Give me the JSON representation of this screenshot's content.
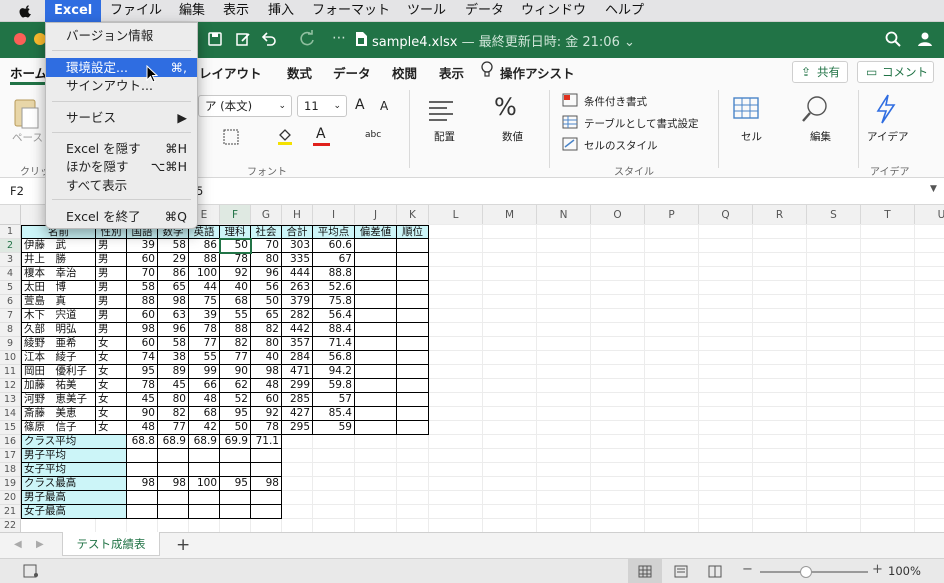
{
  "menubar": {
    "app": "Excel",
    "items": [
      "ファイル",
      "編集",
      "表示",
      "挿入",
      "フォーマット",
      "ツール",
      "データ",
      "ウィンドウ",
      "ヘルプ"
    ]
  },
  "title": {
    "filename": "sample4.xlsx",
    "sub": "— 最終更新日時: 金 21:06",
    "chevron": "⌄"
  },
  "tabs": {
    "home": "ホーム",
    "items": [
      "レイアウト",
      "数式",
      "データ",
      "校閲",
      "表示"
    ],
    "assist": "操作アシスト",
    "share": "共有",
    "comment": "コメント"
  },
  "ribbon": {
    "paste": "ペース",
    "clipboard": "クリッ",
    "font_name": "ア (本文)",
    "font_size": "11",
    "grow": "A",
    "shrink": "A",
    "font_group": "フォント",
    "align": "配置",
    "number": "数値",
    "cond": "条件付き書式",
    "table": "テーブルとして書式設定",
    "cellstyle": "セルのスタイル",
    "style_group": "スタイル",
    "cells": "セル",
    "edit": "編集",
    "ideas": "アイデア",
    "ideas_group": "アイデア",
    "abc": "abc",
    "underline_a": "A",
    "fill_a": "A"
  },
  "formula": {
    "cellref": "F2",
    "value": "5"
  },
  "columns": [
    "A",
    "B",
    "C",
    "D",
    "E",
    "F",
    "G",
    "H",
    "I",
    "J",
    "K",
    "L",
    "M",
    "N",
    "O",
    "P",
    "Q",
    "R",
    "S",
    "T",
    "U",
    "V"
  ],
  "rows": [
    "1",
    "2",
    "3",
    "4",
    "5",
    "6",
    "7",
    "8",
    "9",
    "10",
    "11",
    "12",
    "13",
    "14",
    "15",
    "16",
    "17",
    "18",
    "19",
    "20",
    "21",
    "22"
  ],
  "headers": [
    "名前",
    "性別",
    "国語",
    "数学",
    "英語",
    "理科",
    "社会",
    "合計",
    "平均点",
    "偏差値",
    "順位"
  ],
  "students": [
    [
      "伊藤　武",
      "男",
      "39",
      "58",
      "86",
      "50",
      "70",
      "303",
      "60.6"
    ],
    [
      "井上　勝",
      "男",
      "60",
      "29",
      "88",
      "78",
      "80",
      "335",
      "67"
    ],
    [
      "榎本　幸治",
      "男",
      "70",
      "86",
      "100",
      "92",
      "96",
      "444",
      "88.8"
    ],
    [
      "太田　博",
      "男",
      "58",
      "65",
      "44",
      "40",
      "56",
      "263",
      "52.6"
    ],
    [
      "萱島　真",
      "男",
      "88",
      "98",
      "75",
      "68",
      "50",
      "379",
      "75.8"
    ],
    [
      "木下　宍道",
      "男",
      "60",
      "63",
      "39",
      "55",
      "65",
      "282",
      "56.4"
    ],
    [
      "久部　明弘",
      "男",
      "98",
      "96",
      "78",
      "88",
      "82",
      "442",
      "88.4"
    ],
    [
      "綾野　亜希",
      "女",
      "60",
      "58",
      "77",
      "82",
      "80",
      "357",
      "71.4"
    ],
    [
      "江本　綾子",
      "女",
      "74",
      "38",
      "55",
      "77",
      "40",
      "284",
      "56.8"
    ],
    [
      "岡田　優利子",
      "女",
      "95",
      "89",
      "99",
      "90",
      "98",
      "471",
      "94.2"
    ],
    [
      "加藤　祐美",
      "女",
      "78",
      "45",
      "66",
      "62",
      "48",
      "299",
      "59.8"
    ],
    [
      "河野　恵美子",
      "女",
      "45",
      "80",
      "48",
      "52",
      "60",
      "285",
      "57"
    ],
    [
      "斎藤　美恵",
      "女",
      "90",
      "82",
      "68",
      "95",
      "92",
      "427",
      "85.4"
    ],
    [
      "篠原　信子",
      "女",
      "48",
      "77",
      "42",
      "50",
      "78",
      "295",
      "59"
    ]
  ],
  "summary": [
    {
      "label": "クラス平均",
      "values": [
        "68.8",
        "68.9",
        "68.9",
        "69.9",
        "71.1"
      ]
    },
    {
      "label": "男子平均",
      "values": [
        "",
        "",
        "",
        "",
        ""
      ]
    },
    {
      "label": "女子平均",
      "values": [
        "",
        "",
        "",
        "",
        ""
      ]
    },
    {
      "label": "クラス最高",
      "values": [
        "98",
        "98",
        "100",
        "95",
        "98"
      ]
    },
    {
      "label": "男子最高",
      "values": [
        "",
        "",
        "",
        "",
        ""
      ]
    },
    {
      "label": "女子最高",
      "values": [
        "",
        "",
        "",
        "",
        ""
      ]
    }
  ],
  "sheet": {
    "tab": "テスト成績表",
    "add": "+"
  },
  "status": {
    "zoom": "100%",
    "minus": "−",
    "plus": "+"
  },
  "dropdown": [
    {
      "label": "バージョン情報",
      "shortcut": ""
    },
    {
      "label": "環境設定...",
      "shortcut": "⌘,"
    },
    {
      "label": "サインアウト...",
      "shortcut": ""
    },
    {
      "label": "サービス",
      "shortcut": "▶"
    },
    {
      "label": "Excel を隠す",
      "shortcut": "⌘H"
    },
    {
      "label": "ほかを隠す",
      "shortcut": "⌥⌘H"
    },
    {
      "label": "すべて表示",
      "shortcut": ""
    },
    {
      "label": "Excel を終了",
      "shortcut": "⌘Q"
    }
  ],
  "colors": {
    "excel_green": "#217346",
    "menu_highlight": "#2f6de1",
    "cell_cyan": "#ccf5f8"
  }
}
